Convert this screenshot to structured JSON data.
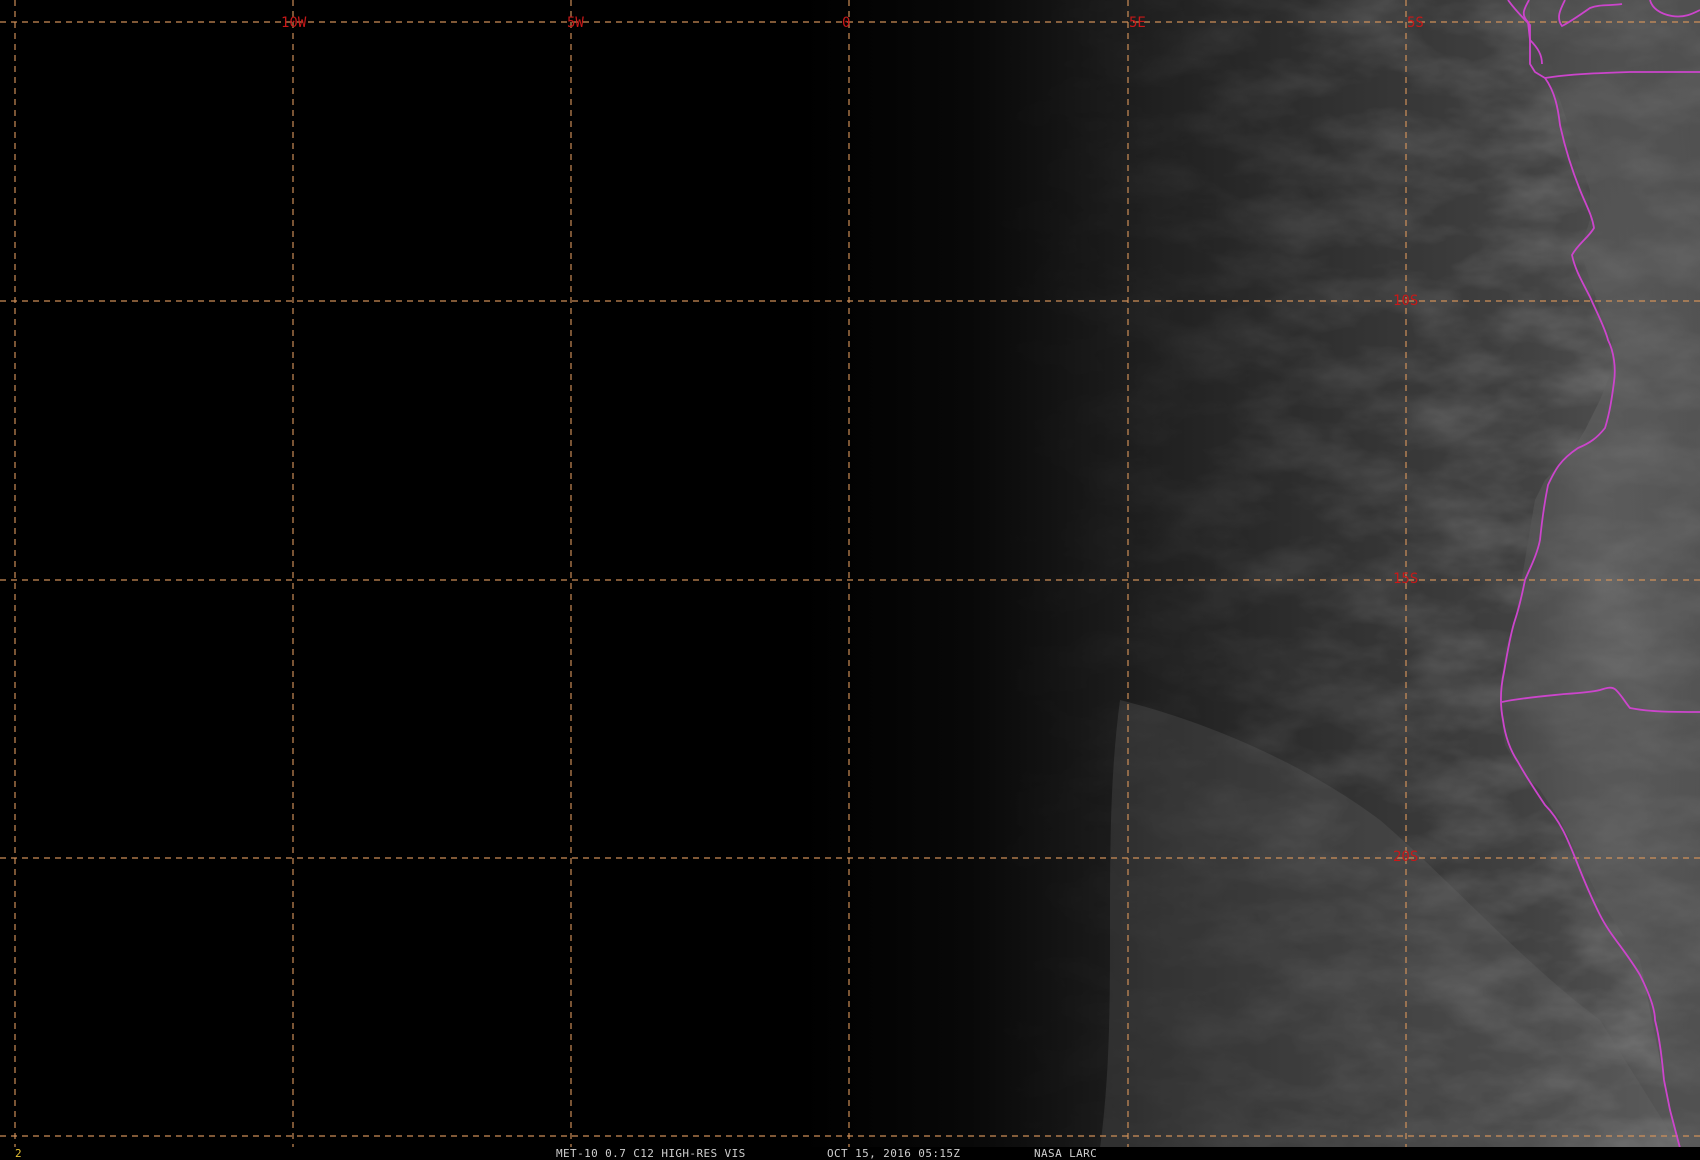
{
  "map": {
    "longitude_labels": [
      "10W",
      "5W",
      "0",
      "5E",
      "5S"
    ],
    "latitude_labels": [
      "10S",
      "15S",
      "20S"
    ],
    "colors": {
      "gridline": "#d7955b",
      "grid_label": "#c81818",
      "political_border": "#cc45cc",
      "footer_text": "#cfcfcf",
      "frame_number": "#e7c233"
    }
  },
  "footer": {
    "frame_number": "2",
    "product": "MET-10 0.7 C12 HIGH-RES VIS",
    "datetime": "OCT 15, 2016 05:15Z",
    "source": "NASA LARC"
  }
}
